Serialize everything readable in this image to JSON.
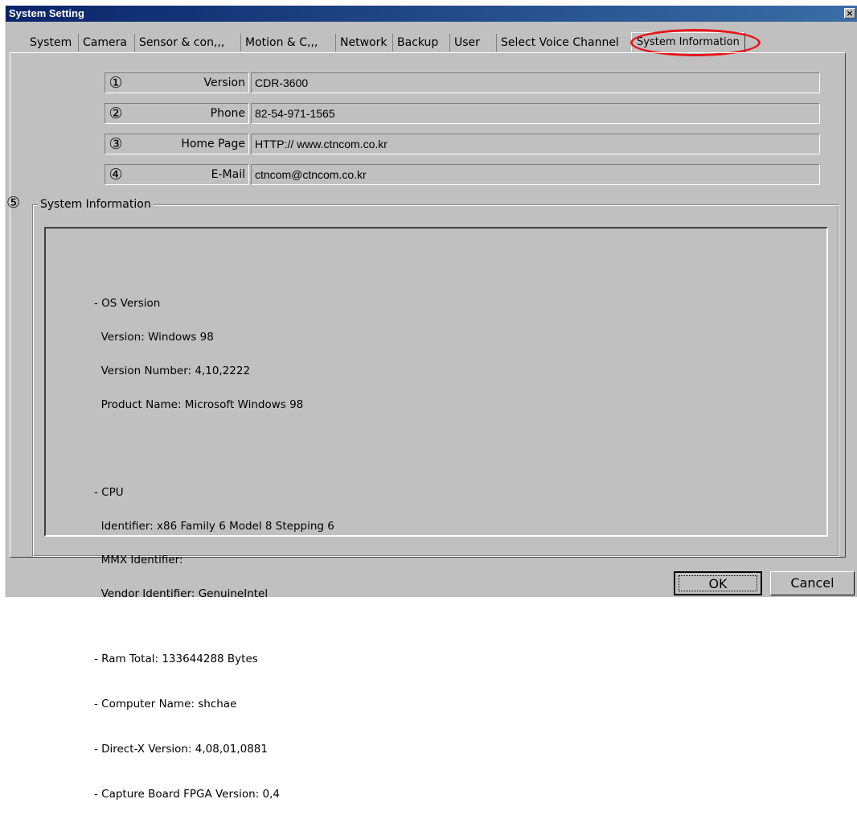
{
  "window": {
    "title": "System Setting",
    "close_label": "×"
  },
  "tabs": [
    {
      "label": "System"
    },
    {
      "label": "Camera"
    },
    {
      "label": "Sensor & con,,,"
    },
    {
      "label": "Motion & C,,,"
    },
    {
      "label": "Network"
    },
    {
      "label": "Backup"
    },
    {
      "label": "User"
    },
    {
      "label": "Select Voice Channel"
    },
    {
      "label": "System Information",
      "active": true
    }
  ],
  "fields": [
    {
      "num": "①",
      "label": "Version",
      "value": "CDR-3600"
    },
    {
      "num": "②",
      "label": "Phone",
      "value": "82-54-971-1565"
    },
    {
      "num": "③",
      "label": "Home Page",
      "value": "HTTP:// www.ctncom.co.kr"
    },
    {
      "num": "④",
      "label": "E-Mail",
      "value": "ctncom@ctncom.co.kr"
    }
  ],
  "system_info": {
    "num": "⑤",
    "group_label": "System Information",
    "os_header": "- OS Version",
    "os_version": "  Version: Windows 98",
    "os_number": "  Version Number: 4,10,2222",
    "os_product": "  Product Name: Microsoft Windows 98",
    "cpu_header": "- CPU",
    "cpu_identifier": "  Identifier: x86 Family 6 Model 8 Stepping 6",
    "cpu_mmx": "  MMX Identifier:",
    "cpu_vendor": "  Vendor Identifier: GenuineIntel",
    "ram": "- Ram Total: 133644288 Bytes",
    "computer_name": "- Computer Name: shchae",
    "directx": "- Direct-X Version: 4,08,01,0881",
    "fpga": "- Capture Board FPGA Version: 0,4"
  },
  "buttons": {
    "ok": "OK",
    "cancel": "Cancel"
  },
  "colors": {
    "annotation_oval": "#e8161c",
    "window_face": "#c0c0c0",
    "titlebar": "#0a246a"
  }
}
